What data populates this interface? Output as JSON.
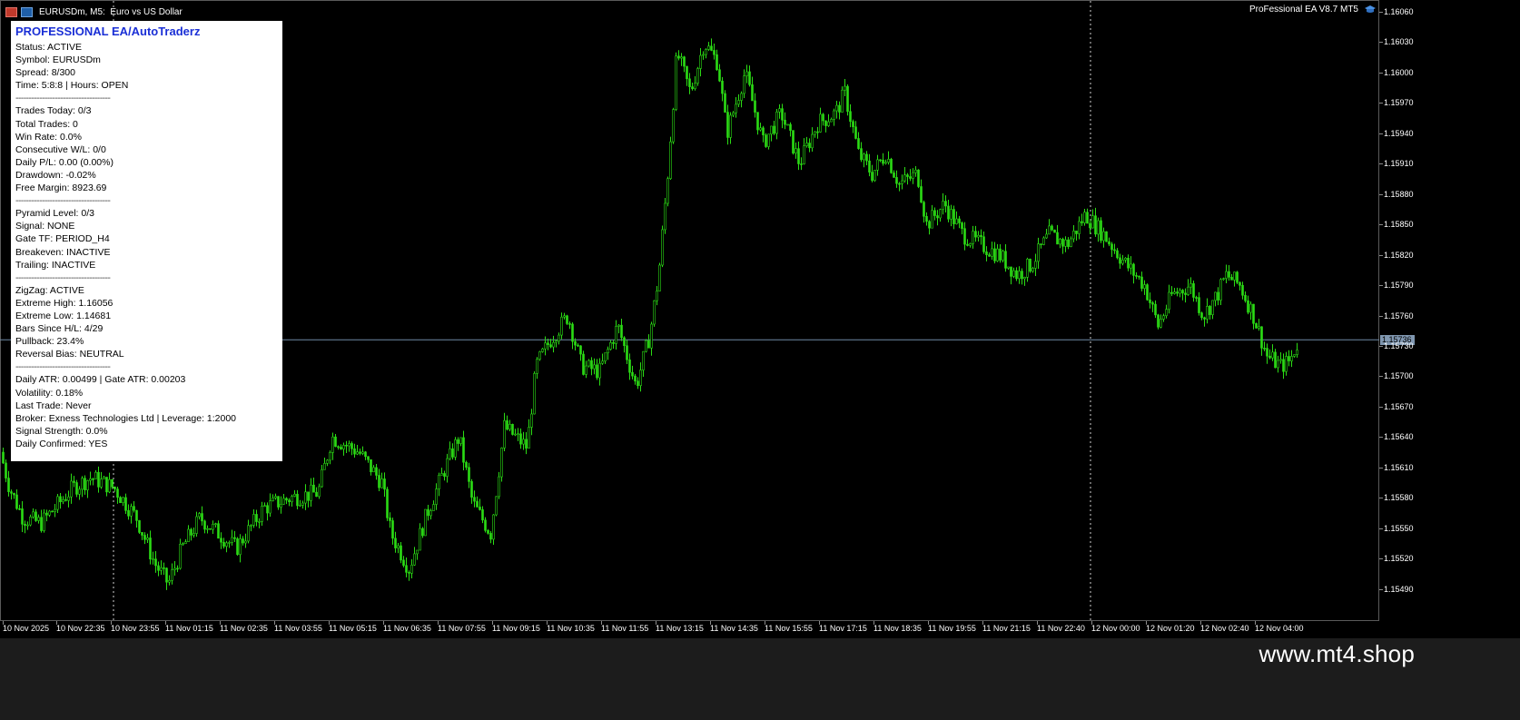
{
  "window": {
    "title": "EURUSDm, M5:  Euro vs US Dollar",
    "ea_badge": "ProFessional EA V8.7 MT5"
  },
  "panel": {
    "title": "PROFESSIONAL EA/AutoTraderz",
    "lines": [
      "Status: ACTIVE",
      "Symbol: EURUSDm",
      "Spread: 8/300",
      "Time: 5:8:8 | Hours: OPEN",
      "------------------------------------",
      "Trades Today: 0/3",
      "Total Trades: 0",
      "Win Rate: 0.0%",
      "Consecutive W/L: 0/0",
      "Daily P/L: 0.00 (0.00%)",
      "Drawdown: -0.02%",
      "Free Margin: 8923.69",
      "------------------------------------",
      "Pyramid Level: 0/3",
      "Signal: NONE",
      "Gate TF: PERIOD_H4",
      "Breakeven: INACTIVE",
      "Trailing: INACTIVE",
      "------------------------------------",
      "ZigZag: ACTIVE",
      "Extreme High: 1.16056",
      "Extreme Low: 1.14681",
      "Bars Since H/L: 4/29",
      "Pullback: 23.4%",
      "Reversal Bias: NEUTRAL",
      "------------------------------------",
      "Daily ATR: 0.00499 | Gate ATR: 0.00203",
      "Volatility: 0.18%",
      "Last Trade: Never",
      "Broker: Exness Technologies Ltd | Leverage: 1:2000",
      "Signal Strength: 0.0%",
      "Daily Confirmed: YES"
    ]
  },
  "price_axis": {
    "ticks": [
      "1.16060",
      "1.16030",
      "1.16000",
      "1.15970",
      "1.15940",
      "1.15910",
      "1.15880",
      "1.15850",
      "1.15820",
      "1.15790",
      "1.15760",
      "1.15730",
      "1.15700",
      "1.15670",
      "1.15640",
      "1.15610",
      "1.15580",
      "1.15550",
      "1.15520",
      "1.15490"
    ],
    "current_price": "1.15736"
  },
  "time_axis": {
    "ticks": [
      "10 Nov 2025",
      "10 Nov 22:35",
      "10 Nov 23:55",
      "11 Nov 01:15",
      "11 Nov 02:35",
      "11 Nov 03:55",
      "11 Nov 05:15",
      "11 Nov 06:35",
      "11 Nov 07:55",
      "11 Nov 09:15",
      "11 Nov 10:35",
      "11 Nov 11:55",
      "11 Nov 13:15",
      "11 Nov 14:35",
      "11 Nov 15:55",
      "11 Nov 17:15",
      "11 Nov 18:35",
      "11 Nov 19:55",
      "11 Nov 21:15",
      "11 Nov 22:40",
      "12 Nov 00:00",
      "12 Nov 01:20",
      "12 Nov 02:40",
      "12 Nov 04:00"
    ]
  },
  "chart_data": {
    "type": "candlestick",
    "symbol": "EURUSDm",
    "timeframe": "M5",
    "ylim": [
      1.15465,
      1.16068
    ],
    "current_price": 1.15736,
    "candle_color": "#2bdc14",
    "path_closes": [
      [
        0,
        1.15625
      ],
      [
        10,
        1.1559
      ],
      [
        25,
        1.1556
      ],
      [
        45,
        1.15555
      ],
      [
        80,
        1.1559
      ],
      [
        100,
        1.156
      ],
      [
        125,
        1.1559
      ],
      [
        150,
        1.1556
      ],
      [
        170,
        1.15515
      ],
      [
        185,
        1.15495
      ],
      [
        200,
        1.1553
      ],
      [
        220,
        1.1556
      ],
      [
        240,
        1.15545
      ],
      [
        260,
        1.1553
      ],
      [
        290,
        1.1557
      ],
      [
        320,
        1.1558
      ],
      [
        350,
        1.15585
      ],
      [
        365,
        1.1564
      ],
      [
        395,
        1.15625
      ],
      [
        420,
        1.15595
      ],
      [
        430,
        1.15545
      ],
      [
        450,
        1.1551
      ],
      [
        470,
        1.15565
      ],
      [
        490,
        1.1561
      ],
      [
        505,
        1.1564
      ],
      [
        520,
        1.15575
      ],
      [
        540,
        1.15545
      ],
      [
        555,
        1.1565
      ],
      [
        580,
        1.1563
      ],
      [
        590,
        1.1571
      ],
      [
        605,
        1.15735
      ],
      [
        625,
        1.1576
      ],
      [
        640,
        1.1571
      ],
      [
        660,
        1.15705
      ],
      [
        680,
        1.1575
      ],
      [
        700,
        1.1569
      ],
      [
        715,
        1.1574
      ],
      [
        725,
        1.158
      ],
      [
        735,
        1.159
      ],
      [
        745,
        1.1602
      ],
      [
        760,
        1.1598
      ],
      [
        775,
        1.1603
      ],
      [
        790,
        1.1601
      ],
      [
        800,
        1.1594
      ],
      [
        820,
        1.16
      ],
      [
        840,
        1.1593
      ],
      [
        860,
        1.1596
      ],
      [
        880,
        1.1591
      ],
      [
        900,
        1.1595
      ],
      [
        920,
        1.1596
      ],
      [
        930,
        1.1598
      ],
      [
        945,
        1.1592
      ],
      [
        960,
        1.159
      ],
      [
        975,
        1.1592
      ],
      [
        990,
        1.1589
      ],
      [
        1010,
        1.159
      ],
      [
        1020,
        1.1585
      ],
      [
        1040,
        1.1587
      ],
      [
        1060,
        1.1584
      ],
      [
        1080,
        1.1583
      ],
      [
        1100,
        1.1582
      ],
      [
        1120,
        1.158
      ],
      [
        1135,
        1.1581
      ],
      [
        1155,
        1.1584
      ],
      [
        1175,
        1.1583
      ],
      [
        1195,
        1.1586
      ],
      [
        1215,
        1.1584
      ],
      [
        1240,
        1.1581
      ],
      [
        1260,
        1.1579
      ],
      [
        1275,
        1.1575
      ],
      [
        1290,
        1.1578
      ],
      [
        1310,
        1.1579
      ],
      [
        1325,
        1.1576
      ],
      [
        1340,
        1.1578
      ],
      [
        1350,
        1.158
      ],
      [
        1365,
        1.1579
      ],
      [
        1380,
        1.1576
      ],
      [
        1395,
        1.1572
      ],
      [
        1410,
        1.1571
      ],
      [
        1420,
        1.15715
      ],
      [
        1430,
        1.15736
      ]
    ]
  }
}
